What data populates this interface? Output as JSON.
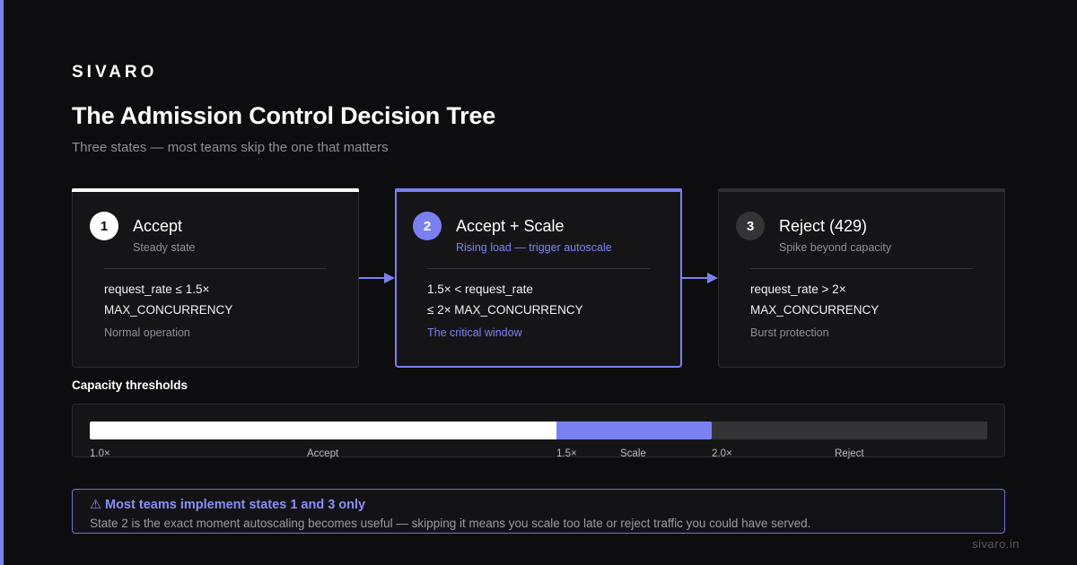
{
  "brand": "SIVARO",
  "title": "The Admission Control Decision Tree",
  "subtitle": "Three states — most teams skip the one that matters",
  "states": [
    {
      "number": "1",
      "title": "Accept",
      "subtitle": "Steady state",
      "condition": [
        "request_rate ≤ 1.5×",
        "MAX_CONCURRENCY"
      ],
      "note": "Normal operation"
    },
    {
      "number": "2",
      "title": "Accept + Scale",
      "subtitle": "Rising load — trigger autoscale",
      "condition": [
        "1.5× < request_rate",
        "≤ 2× MAX_CONCURRENCY"
      ],
      "note": "The critical window"
    },
    {
      "number": "3",
      "title": "Reject (429)",
      "subtitle": "Spike beyond capacity",
      "condition": [
        "request_rate > 2×",
        "MAX_CONCURRENCY"
      ],
      "note": "Burst protection"
    }
  ],
  "thresholds": {
    "label": "Capacity thresholds",
    "scale_min": 1.0,
    "accept_boundary": 1.5,
    "reject_boundary": 2.0,
    "tick_labels": [
      "1.0×",
      "Accept",
      "1.5×",
      "Scale",
      "2.0×",
      "Reject"
    ]
  },
  "warning": {
    "title": "⚠ Most teams implement states 1 and 3 only",
    "body": "State 2 is the exact moment autoscaling becomes useful — skipping it means you scale too late or reject traffic you could have served."
  },
  "footer": "sivaro.in",
  "colors": {
    "accent": "#7b80f0",
    "background": "#0d0d0f",
    "card": "#151518",
    "accept": "#ffffff",
    "reject": "#333338"
  }
}
